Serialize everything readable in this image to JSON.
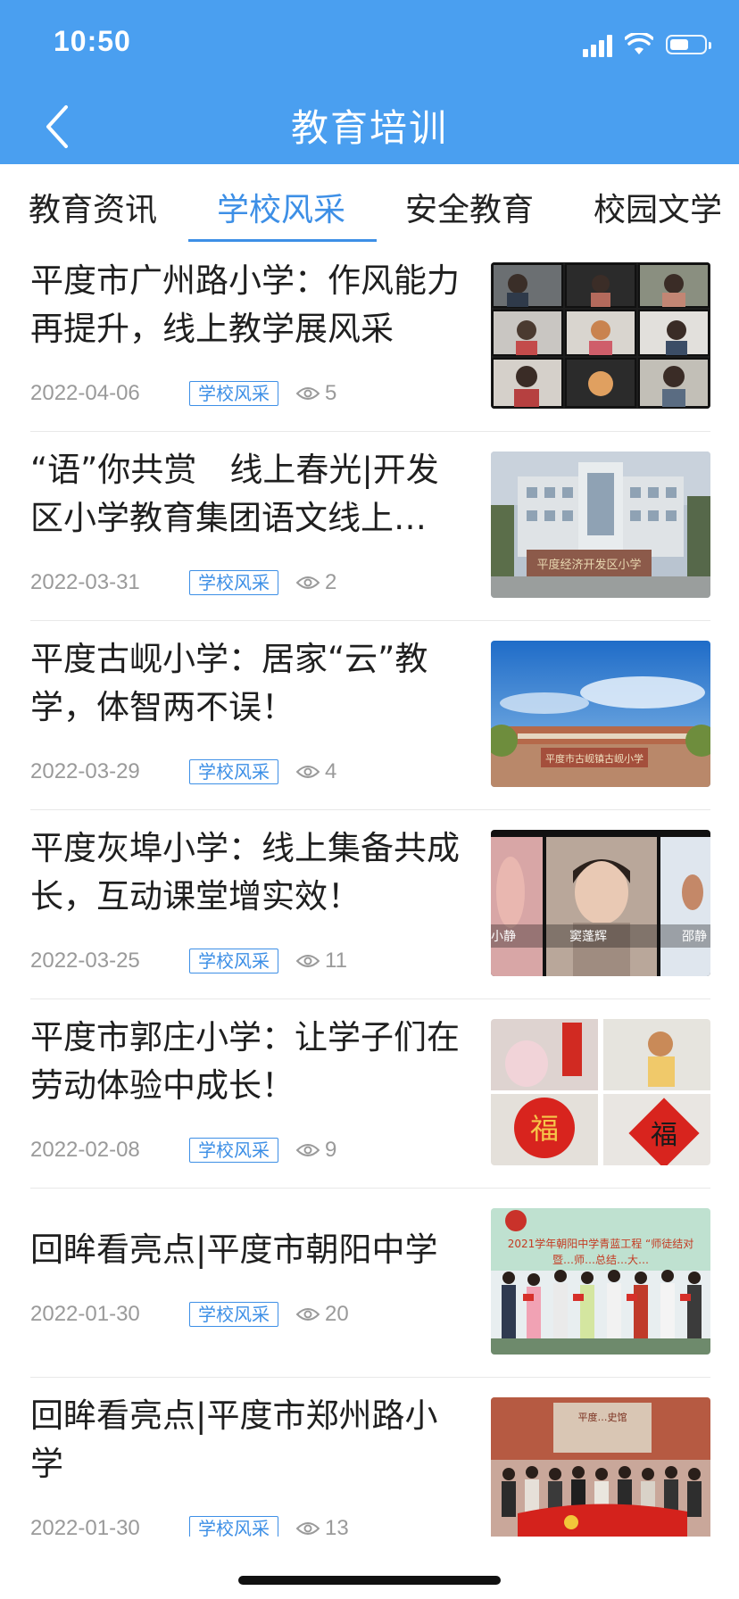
{
  "status_bar": {
    "time": "10:50"
  },
  "header": {
    "title": "教育培训"
  },
  "tabs": [
    {
      "label": "教育资讯"
    },
    {
      "label": "学校风采"
    },
    {
      "label": "安全教育"
    },
    {
      "label": "校园文学"
    }
  ],
  "active_tab": "学校风采",
  "articles": [
    {
      "title": "平度市广州路小学：作风能力再提升，线上教学展风采",
      "date": "2022-04-06",
      "tag": "学校风采",
      "views": "5",
      "thumb": "video-call-grid"
    },
    {
      "title": "“语”你共赏　线上春光|开发区小学教育集团语文线上…",
      "date": "2022-03-31",
      "tag": "学校风采",
      "views": "2",
      "thumb": "school-building",
      "thumb_text": "平度经济开发区小学"
    },
    {
      "title": "平度古岘小学：居家“云”教学，体智两不误！",
      "date": "2022-03-29",
      "tag": "学校风采",
      "views": "4",
      "thumb": "school-gate-blue-sky",
      "thumb_text": "平度市古岘镇古岘小学"
    },
    {
      "title": "平度灰埠小学：线上集备共成长，互动课堂增实效！",
      "date": "2022-03-25",
      "tag": "学校风采",
      "views": "11",
      "thumb": "video-call-teachers",
      "thumb_labels": [
        "小静",
        "窦蓬辉",
        "邵静"
      ]
    },
    {
      "title": "平度市郭庄小学：让学子们在劳动体验中成长！",
      "date": "2022-02-08",
      "tag": "学校风采",
      "views": "9",
      "thumb": "spring-festival-collage",
      "thumb_text": "福"
    },
    {
      "title": "回眸看亮点|平度市朝阳中学",
      "date": "2022-01-30",
      "tag": "学校风采",
      "views": "20",
      "thumb": "stage-group-photo",
      "thumb_text": "2021学年朝阳中学青蓝工程 “师徒结对",
      "thumb_text_2": "暨…师…总结…大…"
    },
    {
      "title": "回眸看亮点|平度市郑州路小学",
      "date": "2022-01-30",
      "tag": "学校风采",
      "views": "13",
      "thumb": "group-photo-flag",
      "thumb_text": "平度…史馆"
    }
  ]
}
